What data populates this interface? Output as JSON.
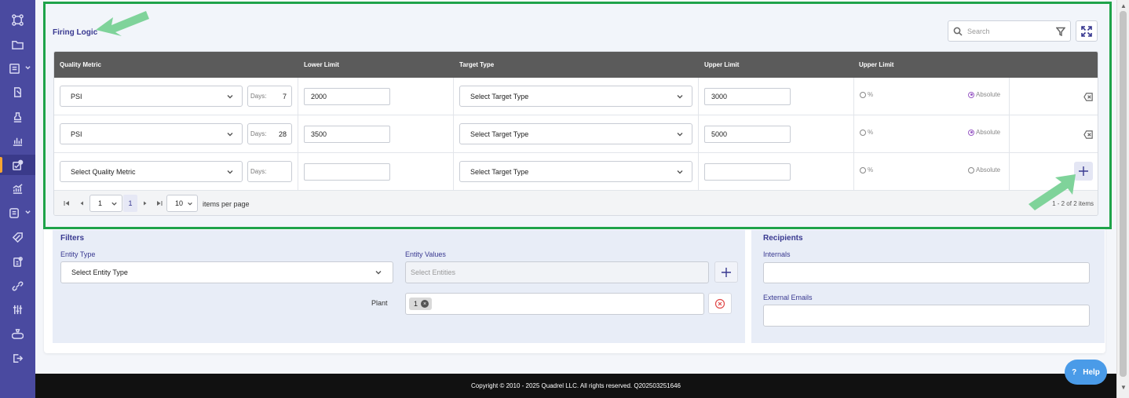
{
  "sidebar": {
    "icons": [
      "hierarchy-icon",
      "folder-icon",
      "form-dropdown-icon",
      "document-edit-icon",
      "stamp-icon",
      "bar-chart-icon",
      "alert-check-icon",
      "trend-chart-icon",
      "notes-dropdown-icon",
      "tag-icon",
      "clipboard-badge-icon",
      "link-icon",
      "sliders-icon",
      "money-bag-icon",
      "logout-icon"
    ],
    "active_index": 6,
    "accent": "#f7a531"
  },
  "firing_logic": {
    "title": "Firing Logic",
    "search_placeholder": "Search",
    "columns": [
      "Quality Metric",
      "Lower Limit",
      "Target Type",
      "Upper Limit",
      "Upper Limit"
    ],
    "rows": [
      {
        "metric": "PSI",
        "days_label": "Days:",
        "days": "7",
        "lower": "2000",
        "target": "Select Target Type",
        "upper": "3000",
        "pct_label": "%",
        "abs_label": "Absolute",
        "pct_on": false,
        "abs_on": true
      },
      {
        "metric": "PSI",
        "days_label": "Days:",
        "days": "28",
        "lower": "3500",
        "target": "Select Target Type",
        "upper": "5000",
        "pct_label": "%",
        "abs_label": "Absolute",
        "pct_on": false,
        "abs_on": true
      },
      {
        "metric": "Select Quality Metric",
        "days_label": "Days:",
        "days": "",
        "lower": "",
        "target": "Select Target Type",
        "upper": "",
        "pct_label": "%",
        "abs_label": "Absolute",
        "pct_on": false,
        "abs_on": false
      }
    ],
    "pager": {
      "page_select": "1",
      "current_page": "1",
      "page_size": "10",
      "items_per_page_label": "items per page",
      "summary": "1 - 2 of 2 items"
    }
  },
  "filters": {
    "title": "Filters",
    "entity_type_label": "Entity Type",
    "entity_type_value": "Select Entity Type",
    "entity_values_label": "Entity Values",
    "entity_values_placeholder": "Select Entities",
    "plant_label": "Plant",
    "plant_chip": "1"
  },
  "recipients": {
    "title": "Recipients",
    "internals_label": "Internals",
    "external_label": "External Emails"
  },
  "footer": {
    "copyright": "Copyright © 2010 - 2025 Quadrel LLC. All rights reserved. Q202503251646"
  },
  "help": {
    "icon": "?",
    "label": "Help"
  },
  "colors": {
    "highlight_border": "#1fa34a",
    "primary": "#383890",
    "sidebar": "#4a4aa0",
    "arrow": "#7fd39a"
  }
}
